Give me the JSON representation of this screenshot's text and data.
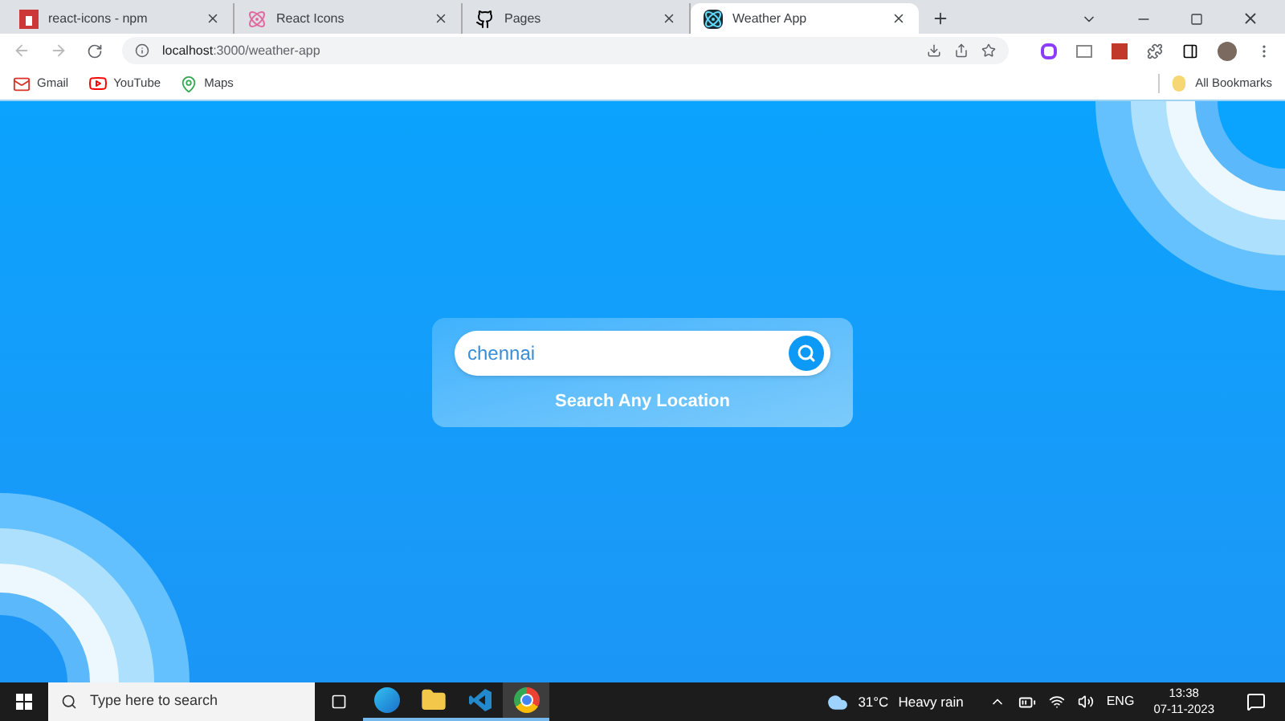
{
  "tabs": [
    {
      "title": "react-icons - npm",
      "kind": "npm",
      "selected": false
    },
    {
      "title": "React Icons",
      "kind": "react",
      "selected": false
    },
    {
      "title": "Pages",
      "kind": "github",
      "selected": false
    },
    {
      "title": "Weather App",
      "kind": "app",
      "selected": true
    }
  ],
  "address": {
    "host": "localhost",
    "path": ":3000/weather-app"
  },
  "bookmarks": [
    {
      "label": "Gmail",
      "kind": "gmail"
    },
    {
      "label": "YouTube",
      "kind": "youtube"
    },
    {
      "label": "Maps",
      "kind": "maps"
    }
  ],
  "all_bookmarks": "All Bookmarks",
  "search": {
    "value": "chennai",
    "caption": "Search Any Location"
  },
  "taskbar": {
    "search_placeholder": "Type here to search",
    "apps": [
      {
        "kind": "edge",
        "selected": false
      },
      {
        "kind": "explorer",
        "selected": false
      },
      {
        "kind": "vscode",
        "selected": false
      },
      {
        "kind": "chrome",
        "selected": true
      }
    ],
    "weather": {
      "temp": "31°C",
      "condition": "Heavy rain"
    },
    "language": "ENG",
    "time": "13:38",
    "date": "07-11-2023"
  }
}
